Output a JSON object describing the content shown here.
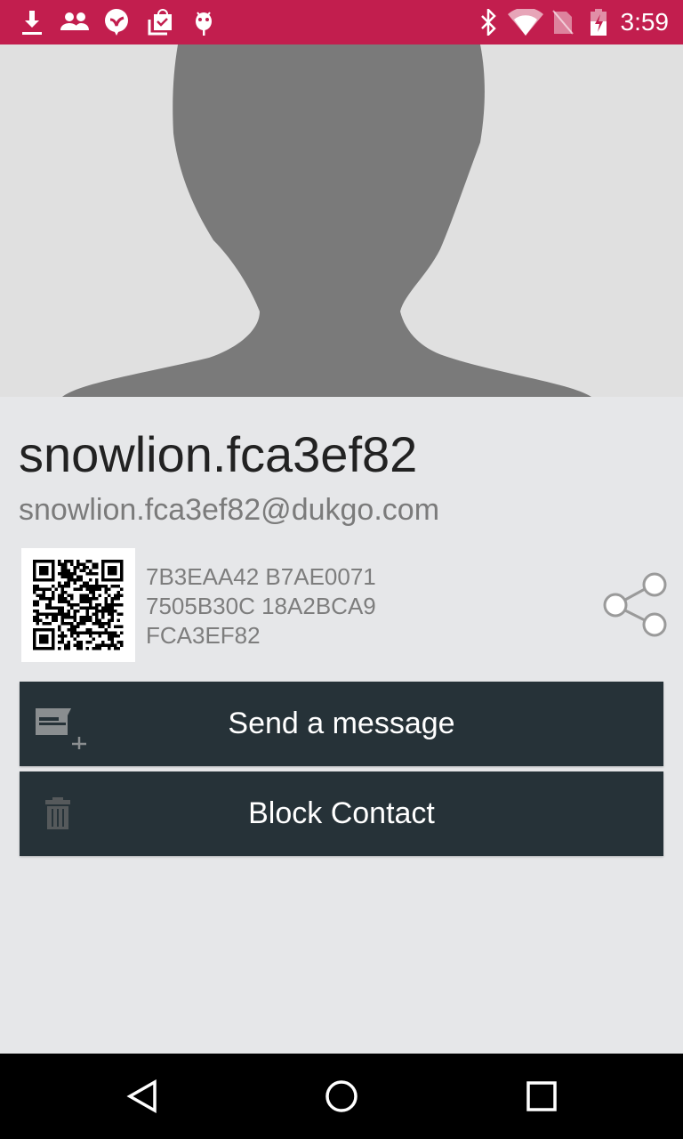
{
  "status_bar": {
    "time": "3:59",
    "left_icons": [
      "download-icon",
      "people-icon",
      "chat-bubble-icon",
      "shopping-bag-check-icon",
      "android-icon"
    ],
    "right_icons": [
      "bluetooth-icon",
      "wifi-icon",
      "no-sim-icon",
      "battery-charging-icon"
    ],
    "color": "#c21e4e"
  },
  "contact": {
    "display_name": "snowlion.fca3ef82",
    "email": "snowlion.fca3ef82@dukgo.com",
    "fingerprint_lines": [
      "7B3EAA42 B7AE0071",
      "7505B30C 18A2BCA9",
      "FCA3EF82"
    ]
  },
  "actions": {
    "send_message": "Send a message",
    "block_contact": "Block Contact"
  },
  "nav_bar": {
    "buttons": [
      "back",
      "home",
      "recents"
    ]
  }
}
